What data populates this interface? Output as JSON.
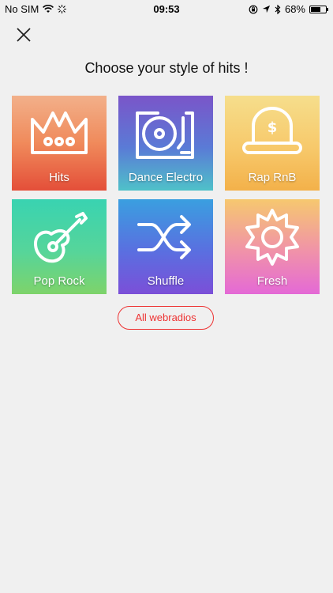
{
  "status_bar": {
    "carrier": "No SIM",
    "time": "09:53",
    "battery": "68%",
    "battery_level": 0.68
  },
  "header": {
    "title": "Choose your style of hits !"
  },
  "styles": [
    {
      "label": "Hits",
      "icon": "crown-icon"
    },
    {
      "label": "Dance Electro",
      "icon": "turntable-icon"
    },
    {
      "label": "Rap RnB",
      "icon": "cap-icon"
    },
    {
      "label": "Pop Rock",
      "icon": "guitar-icon"
    },
    {
      "label": "Shuffle",
      "icon": "shuffle-icon"
    },
    {
      "label": "Fresh",
      "icon": "sun-icon"
    }
  ],
  "actions": {
    "all_webradios": "All webradios"
  },
  "colors": {
    "accent": "#e33333",
    "background": "#f0f0f0"
  }
}
